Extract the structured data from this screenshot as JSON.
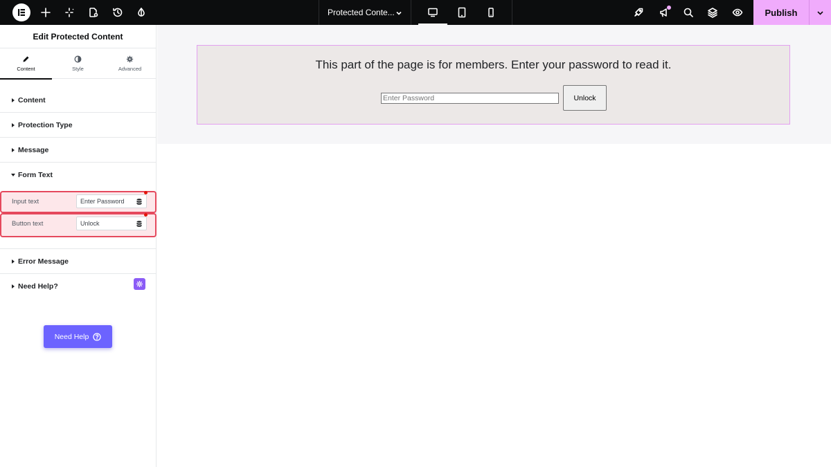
{
  "topbar": {
    "document_title": "Protected Conte...",
    "publish_label": "Publish",
    "left_icons": [
      "elementor-logo-icon",
      "plus-icon",
      "sparkle-icon",
      "page-settings-icon",
      "history-icon",
      "theme-style-icon"
    ],
    "devices": [
      "desktop-icon",
      "tablet-icon",
      "mobile-icon"
    ],
    "active_device": "desktop",
    "right_icons": [
      "rocket-icon",
      "megaphone-icon",
      "search-icon",
      "layers-icon",
      "eye-icon"
    ],
    "accent_color": "#f0abfc"
  },
  "panel": {
    "title": "Edit Protected Content",
    "tabs": [
      {
        "label": "Content",
        "icon": "pencil-icon",
        "active": true
      },
      {
        "label": "Style",
        "icon": "half-circle-icon",
        "active": false
      },
      {
        "label": "Advanced",
        "icon": "gear-icon",
        "active": false
      }
    ],
    "sections": {
      "content": "Content",
      "protection_type": "Protection Type",
      "message": "Message",
      "form_text": "Form Text",
      "error_message": "Error Message",
      "need_help": "Need Help?"
    },
    "form_text": {
      "input_label": "Input text",
      "input_value": "Enter Password",
      "button_label": "Button text",
      "button_value": "Unlock"
    },
    "need_help_button": "Need Help",
    "help_color": "#6c63ff"
  },
  "preview": {
    "message": "This part of the page is for members. Enter your password to read it.",
    "password_placeholder": "Enter Password",
    "unlock_button": "Unlock"
  }
}
